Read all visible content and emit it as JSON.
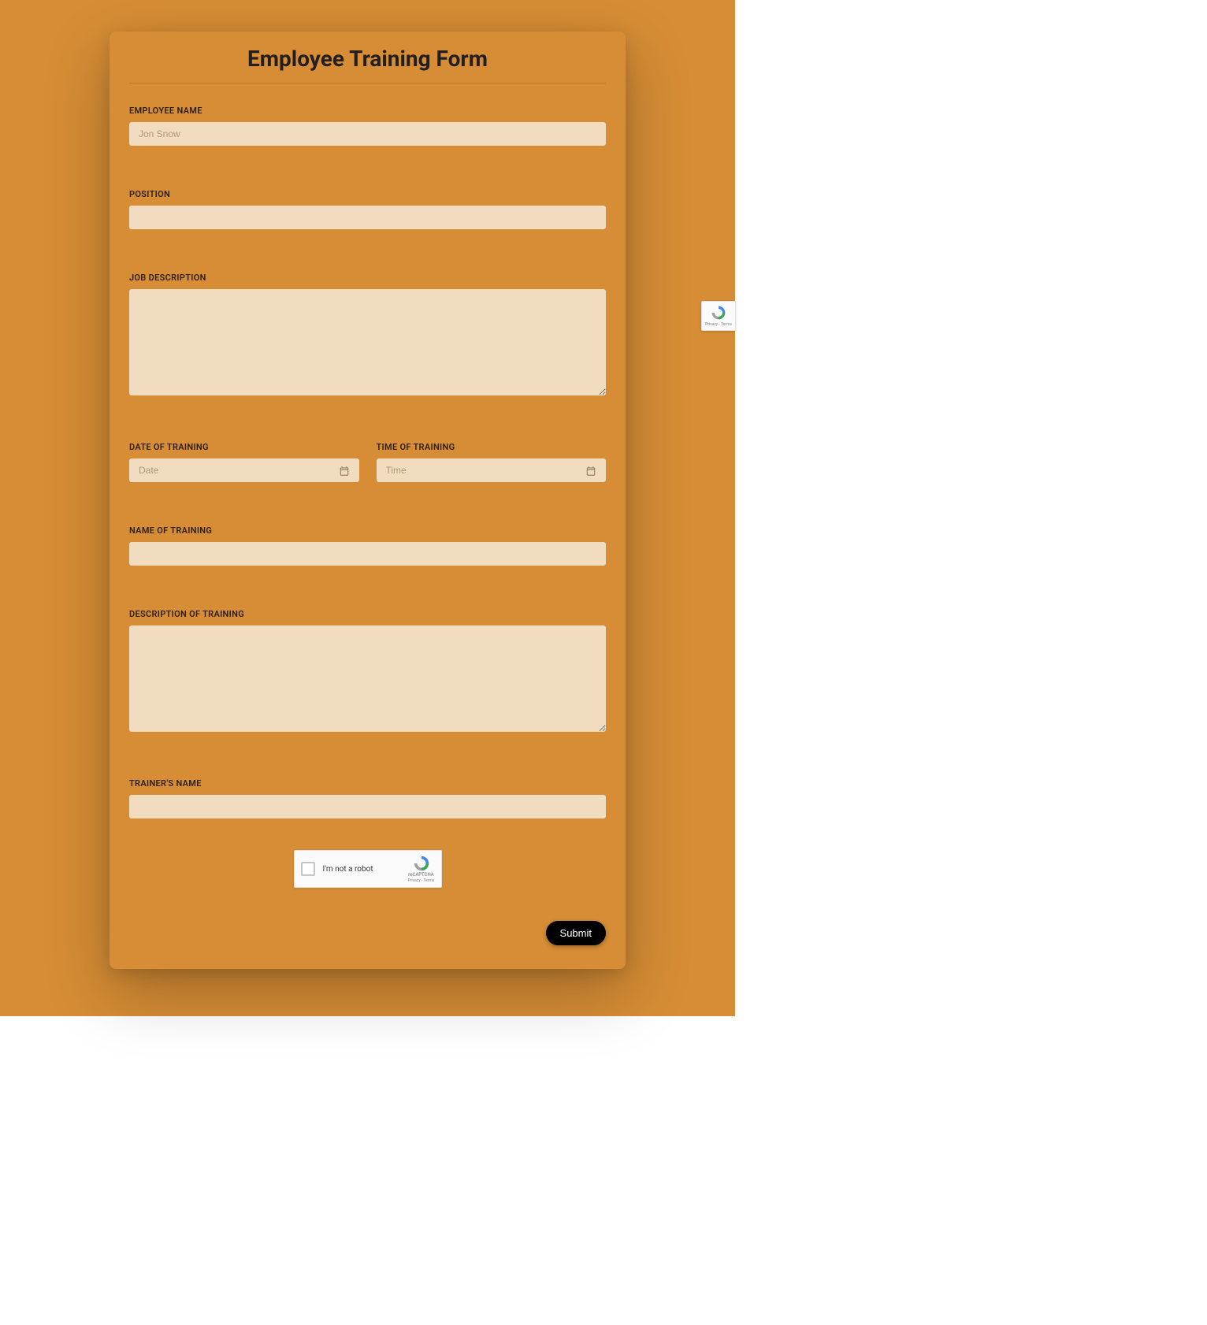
{
  "form": {
    "title": "Employee Training Form",
    "fields": {
      "employee_name": {
        "label": "EMPLOYEE NAME",
        "placeholder": "Jon Snow",
        "value": ""
      },
      "position": {
        "label": "POSITION",
        "placeholder": "",
        "value": ""
      },
      "job_description": {
        "label": "JOB DESCRIPTION",
        "value": ""
      },
      "date_of_training": {
        "label": "DATE OF TRAINING",
        "placeholder": "Date",
        "value": ""
      },
      "time_of_training": {
        "label": "TIME OF TRAINING",
        "placeholder": "Time",
        "value": ""
      },
      "name_of_training": {
        "label": "NAME OF TRAINING",
        "value": ""
      },
      "description_of_training": {
        "label": "DESCRIPTION OF TRAINING",
        "value": ""
      },
      "trainer_name": {
        "label": "TRAINER'S NAME",
        "value": ""
      }
    },
    "recaptcha": {
      "label": "I'm not a robot",
      "logo_text": "reCAPTCHA",
      "terms": "Privacy - Terms"
    },
    "submit_label": "Submit"
  }
}
